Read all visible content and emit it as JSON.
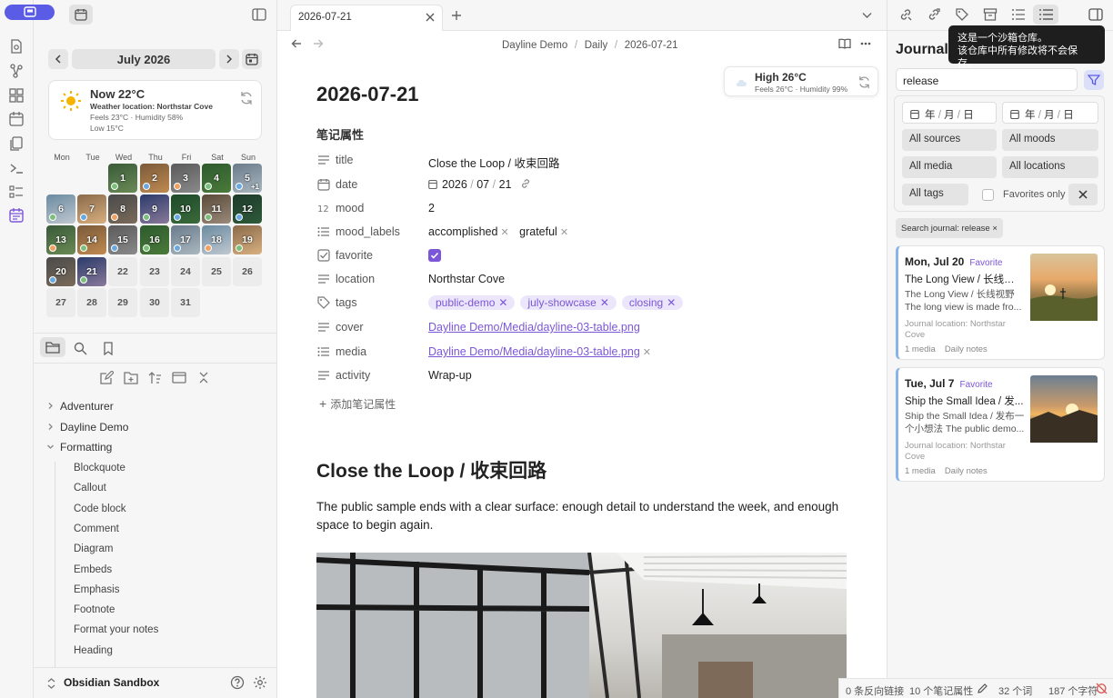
{
  "sidebar_top": {
    "toggle_label": "ribbon"
  },
  "calendar": {
    "month_label": "July 2026",
    "weather": {
      "now": "Now 22°C",
      "location": "Weather location: Northstar Cove",
      "details": "Feels 23°C · Humidity 58%",
      "low": "Low 15°C"
    },
    "weekdays": [
      "Mon",
      "Tue",
      "Wed",
      "Thu",
      "Fri",
      "Sat",
      "Sun"
    ],
    "days": [
      "1",
      "2",
      "3",
      "4",
      "5",
      "6",
      "7",
      "8",
      "9",
      "10",
      "11",
      "12",
      "13",
      "14",
      "15",
      "16",
      "17",
      "18",
      "19",
      "20",
      "21",
      "22",
      "23",
      "24",
      "25",
      "26",
      "27",
      "28",
      "29",
      "30",
      "31"
    ],
    "more_badge": "+1"
  },
  "file_tree": {
    "folders": [
      "Adventurer",
      "Dayline Demo",
      "Formatting"
    ],
    "children": [
      "Blockquote",
      "Callout",
      "Code block",
      "Comment",
      "Diagram",
      "Embeds",
      "Emphasis",
      "Footnote",
      "Format your notes",
      "Heading"
    ]
  },
  "vault": {
    "name": "Obsidian Sandbox"
  },
  "tab": {
    "title": "2026-07-21"
  },
  "breadcrumb": [
    "Dayline Demo",
    "Daily",
    "2026-07-21"
  ],
  "weather_chip": {
    "high": "High 26°C",
    "details": "Feels 26°C · Humidity 99%"
  },
  "note": {
    "title": "2026-07-21",
    "props_heading": "笔记属性",
    "props": {
      "title": {
        "key": "title",
        "value": "Close the Loop / 收束回路"
      },
      "date": {
        "key": "date",
        "year": "2026",
        "month": "07",
        "day": "21"
      },
      "mood": {
        "key": "mood",
        "value": "2"
      },
      "mood_labels": {
        "key": "mood_labels",
        "values": [
          "accomplished",
          "grateful"
        ]
      },
      "favorite": {
        "key": "favorite"
      },
      "location": {
        "key": "location",
        "value": "Northstar Cove"
      },
      "tags": {
        "key": "tags",
        "values": [
          "public-demo",
          "july-showcase",
          "closing"
        ]
      },
      "cover": {
        "key": "cover",
        "value": "Dayline Demo/Media/dayline-03-table.png"
      },
      "media": {
        "key": "media",
        "value": "Dayline Demo/Media/dayline-03-table.png"
      },
      "activity": {
        "key": "activity",
        "value": "Wrap-up"
      }
    },
    "add_prop": "添加笔记属性",
    "heading": "Close the Loop / 收束回路",
    "body": "The public sample ends with a clear surface: enough detail to understand the week, and enough space to begin again."
  },
  "journal": {
    "title": "Journal t",
    "search_value": "release",
    "date_placeholder": "年 / 月 / 日",
    "date_year": "年",
    "date_month": "月",
    "date_day": "日",
    "filters": [
      "All sources",
      "All moods",
      "All media",
      "All locations",
      "All tags"
    ],
    "favorites_only": "Favorites only",
    "search_chip": "Search journal: release ×",
    "entries": [
      {
        "date": "Mon, Jul 20",
        "fav": "Favorite",
        "title": "The Long View / 长线视野",
        "s1": "The Long View / 长线视野",
        "s2": "The long view is made fro...",
        "loc": "Journal location: Northstar Cove",
        "media": "1 media",
        "kind": "Daily notes"
      },
      {
        "date": "Tue, Jul 7",
        "fav": "Favorite",
        "title": "Ship the Small Idea / 发...",
        "s1": "Ship the Small Idea / 发布一",
        "s2": "个小想法 The public demo...",
        "loc": "Journal location: Northstar Cove",
        "media": "1 media",
        "kind": "Daily notes"
      }
    ]
  },
  "tooltip": {
    "line1": "这是一个沙箱仓库。",
    "line2": "该仓库中所有修改将不会保存。"
  },
  "status": {
    "backlinks": "0 条反向链接",
    "props": "10 个笔记属性",
    "words": "32 个词",
    "chars": "187 个字符"
  },
  "colors": {
    "accent": "#7b56d8",
    "ribbon_active": "#5b5ce6"
  }
}
